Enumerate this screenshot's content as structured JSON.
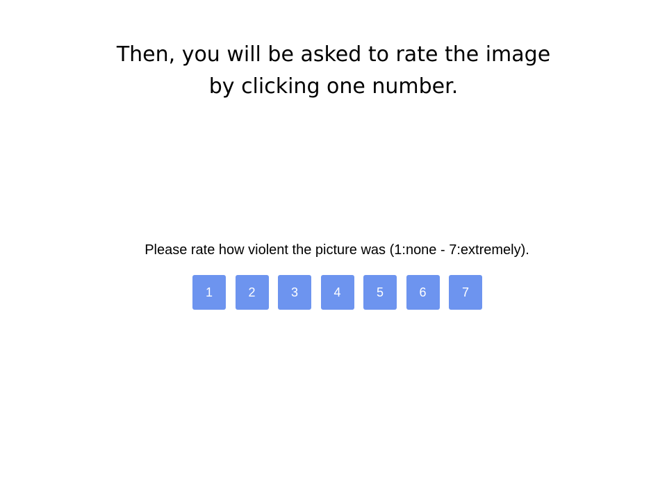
{
  "instruction": {
    "line1": "Then, you will be asked to rate the image",
    "line2": "by clicking one number."
  },
  "rating": {
    "prompt": "Please rate how violent the picture was (1:none - 7:extremely).",
    "options": [
      "1",
      "2",
      "3",
      "4",
      "5",
      "6",
      "7"
    ],
    "button_color": "#6d94ef"
  }
}
